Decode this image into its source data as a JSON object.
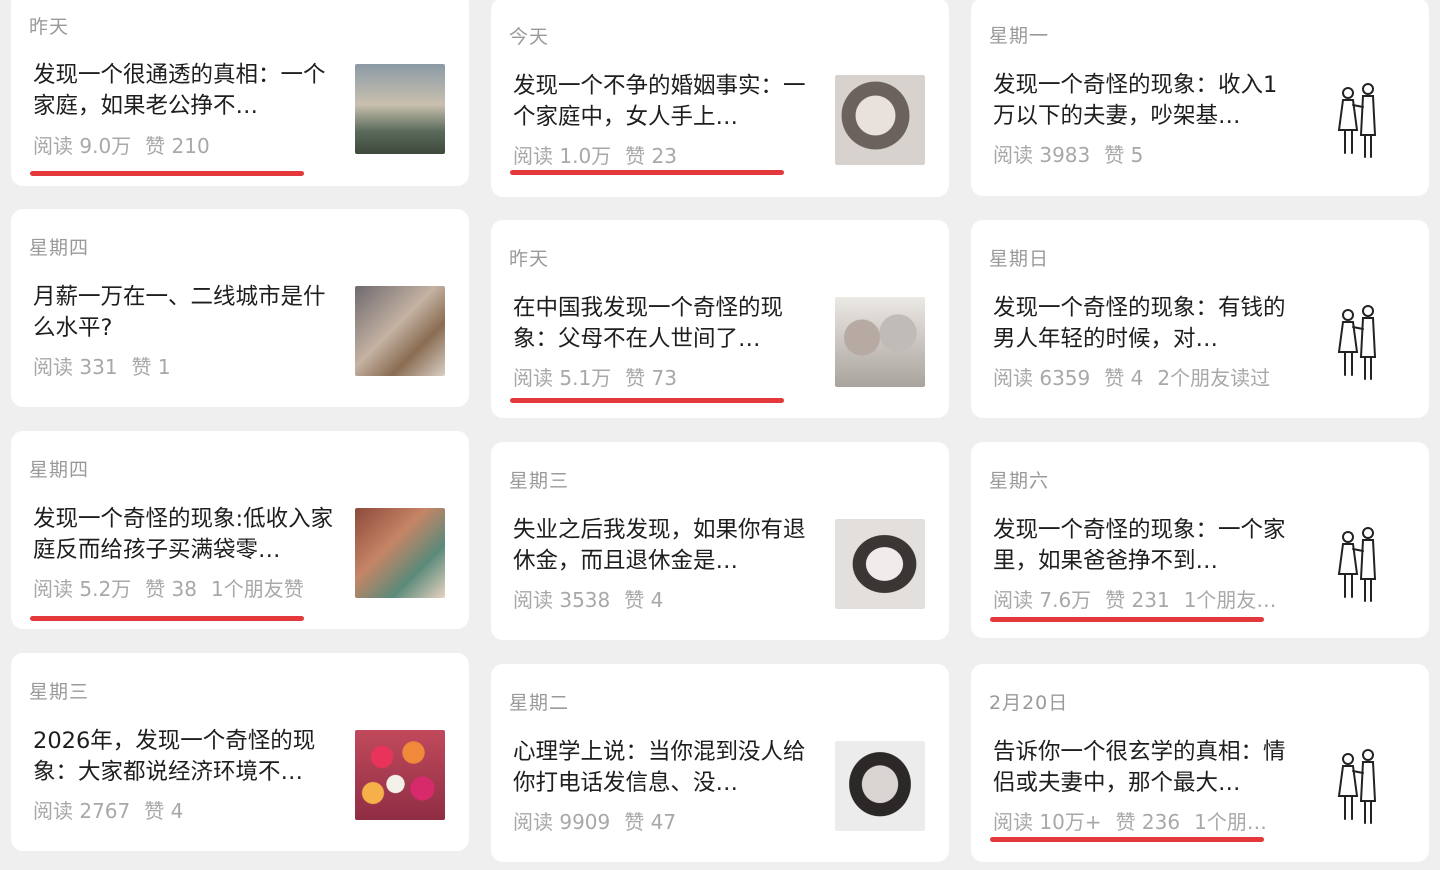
{
  "columns": [
    {
      "cards": [
        {
          "date": "昨天",
          "title": "发现一个很通透的真相：一个家庭，如果老公挣不…",
          "stats": [
            "阅读 9.0万",
            "赞 210"
          ],
          "highlighted": true,
          "thumb": "photo-woman-sky"
        },
        {
          "date": "星期四",
          "title": "月薪一万在一、二线城市是什么水平?",
          "stats": [
            "阅读 331",
            "赞 1"
          ],
          "highlighted": false,
          "thumb": "photo-two-girls"
        },
        {
          "date": "星期四",
          "title": "发现一个奇怪的现象:低收入家庭反而给孩子买满袋零…",
          "stats": [
            "阅读 5.2万",
            "赞 38",
            "1个朋友赞"
          ],
          "highlighted": true,
          "thumb": "photo-child"
        },
        {
          "date": "星期三",
          "title": "2026年，发现一个奇怪的现象：大家都说经济环境不…",
          "stats": [
            "阅读 2767",
            "赞 4"
          ],
          "highlighted": false,
          "thumb": "photo-flowers"
        }
      ]
    },
    {
      "cards": [
        {
          "date": "今天",
          "title": "发现一个不争的婚姻事实：一个家庭中，女人手上…",
          "stats": [
            "阅读 1.0万",
            "赞 23"
          ],
          "highlighted": true,
          "thumb": "sketch-woman-face"
        },
        {
          "date": "昨天",
          "title": "在中国我发现一个奇怪的现象：父母不在人世间了…",
          "stats": [
            "阅读 5.1万",
            "赞 73"
          ],
          "highlighted": true,
          "thumb": "sketch-elderly-couple"
        },
        {
          "date": "星期三",
          "title": "失业之后我发现，如果你有退休金，而且退休金是…",
          "stats": [
            "阅读 3538",
            "赞 4"
          ],
          "highlighted": false,
          "thumb": "sketch-woman-face"
        },
        {
          "date": "星期二",
          "title": "心理学上说：当你混到没人给你打电话发信息、没…",
          "stats": [
            "阅读 9909",
            "赞 47"
          ],
          "highlighted": false,
          "thumb": "sketch-woman-face"
        }
      ]
    },
    {
      "cards": [
        {
          "date": "星期一",
          "title": "发现一个奇怪的现象：收入1万以下的夫妻，吵架基…",
          "stats": [
            "阅读 3983",
            "赞 5"
          ],
          "highlighted": false,
          "thumb": "line-art-couple"
        },
        {
          "date": "星期日",
          "title": "发现一个奇怪的现象：有钱的男人年轻的时候，对…",
          "stats": [
            "阅读 6359",
            "赞 4",
            "2个朋友读过"
          ],
          "highlighted": false,
          "thumb": "line-art-couple"
        },
        {
          "date": "星期六",
          "title": "发现一个奇怪的现象：一个家里，如果爸爸挣不到…",
          "stats": [
            "阅读 7.6万",
            "赞 231",
            "1个朋友…"
          ],
          "highlighted": true,
          "thumb": "line-art-couple"
        },
        {
          "date": "2月20日",
          "title": "告诉你一个很玄学的真相：情侣或夫妻中，那个最大…",
          "stats": [
            "阅读 10万+",
            "赞 236",
            "1个朋…"
          ],
          "highlighted": true,
          "thumb": "line-art-couple"
        }
      ]
    }
  ],
  "colors": {
    "accent_underline": "#e4393c",
    "card_bg": "#ffffff",
    "page_bg": "#efefef"
  }
}
